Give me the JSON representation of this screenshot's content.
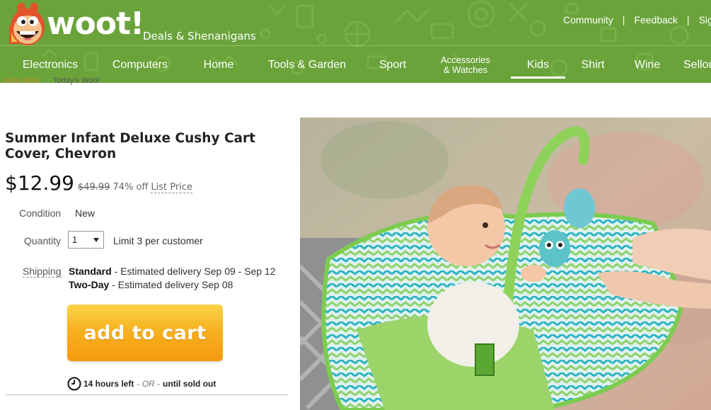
{
  "brand": {
    "logo_text": "woot!",
    "tagline": "Deals & Shenanigans"
  },
  "header_links": [
    "Community",
    "Feedback",
    "Sign"
  ],
  "nav": {
    "items": [
      "Electronics",
      "Computers",
      "Home",
      "Tools & Garden",
      "Sport",
      "Accessories",
      "& Watches",
      "Kids",
      "Shirt",
      "Wine",
      "Sellout"
    ],
    "active": "Kids"
  },
  "breadcrumb": {
    "parent": "Kids.Woot",
    "arrow": "→",
    "current": "Today's Woot"
  },
  "product": {
    "title": "Summer Infant Deluxe Cushy Cart Cover, Chevron",
    "price": "$12.99",
    "list_price": "$49.99",
    "discount": "74% off",
    "list_price_label": "List Price",
    "condition_label": "Condition",
    "condition_value": "New",
    "quantity_label": "Quantity",
    "quantity_value": "1",
    "limit_text": "Limit 3 per customer",
    "shipping_label": "Shipping",
    "shipping_options": [
      {
        "method": "Standard",
        "text": " - Estimated delivery Sep 09 - Sep 12"
      },
      {
        "method": "Two-Day",
        "text": " - Estimated delivery Sep 08"
      }
    ],
    "add_to_cart": "add to cart",
    "time_left": "14 hours left",
    "or": "- OR -",
    "until": "until sold out"
  },
  "colors": {
    "header_green": "#6aa33a",
    "cart_orange": "#f7b21f",
    "crumb_link": "#c98b2b"
  }
}
